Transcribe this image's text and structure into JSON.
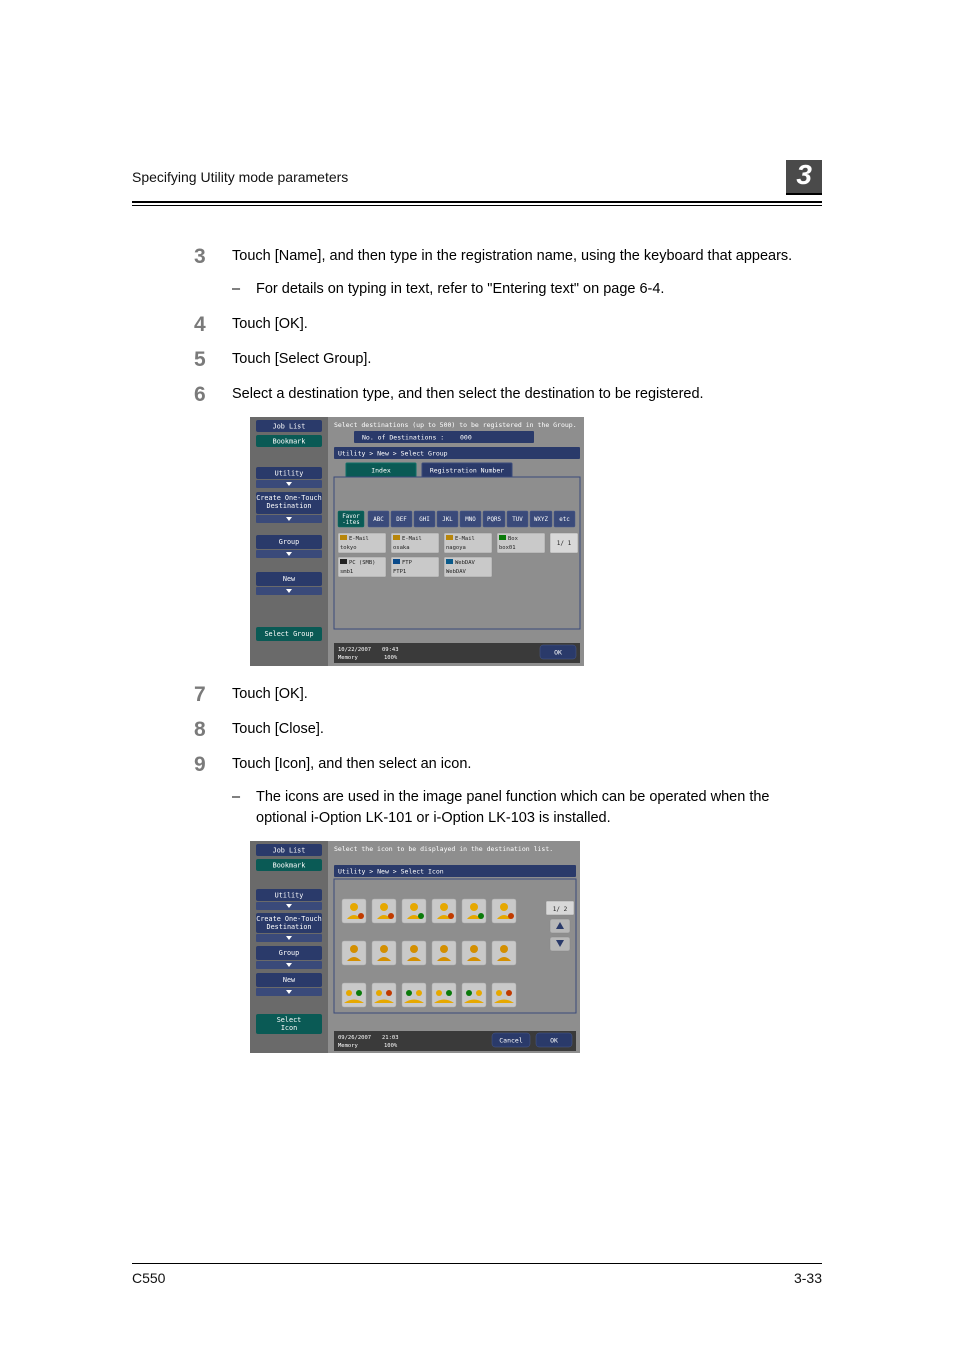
{
  "header": {
    "title": "Specifying Utility mode parameters",
    "chapter": "3"
  },
  "steps": {
    "s3": {
      "num": "3",
      "text": "Touch [Name], and then type in the registration name, using the keyboard that appears.",
      "sub": "For details on typing in text, refer to \"Entering text\" on page 6-4."
    },
    "s4": {
      "num": "4",
      "text": "Touch [OK]."
    },
    "s5": {
      "num": "5",
      "text": "Touch [Select Group]."
    },
    "s6": {
      "num": "6",
      "text": "Select a destination type, and then select the destination to be registered."
    },
    "s7": {
      "num": "7",
      "text": "Touch [OK]."
    },
    "s8": {
      "num": "8",
      "text": "Touch [Close]."
    },
    "s9": {
      "num": "9",
      "text": "Touch [Icon], and then select an icon.",
      "sub": "The icons are used in the image panel function which can be operated when the optional i-Option LK-101 or i-Option LK-103 is installed."
    }
  },
  "fig1": {
    "instr": "Select destinations (up to 500) to be registered in the Group.",
    "dest_count_label": "No. of Destinations :",
    "dest_count_value": "000",
    "crumb": "Utility > New > Select Group",
    "tab_index": "Index",
    "tab_regnum": "Registration Number",
    "sidebar": {
      "job_list": "Job List",
      "bookmark": "Bookmark",
      "utility": "Utility",
      "create": "Create One-Touch\nDestination",
      "group": "Group",
      "new": "New",
      "select_group": "Select Group"
    },
    "idx": {
      "favor": "Favor-\nites",
      "abc": "ABC",
      "def": "DEF",
      "ghi": "GHI",
      "jkl": "JKL",
      "mno": "MNO",
      "pqrs": "PQRS",
      "tuv": "TUV",
      "wxyz": "WXYZ",
      "etc": "etc"
    },
    "dest": {
      "d1": {
        "type": "E-Mail",
        "name": "tokyo"
      },
      "d2": {
        "type": "E-Mail",
        "name": "osaka"
      },
      "d3": {
        "type": "E-Mail",
        "name": "nagoya"
      },
      "d4": {
        "type": "Box",
        "name": "box01"
      },
      "d5": {
        "type": "PC (SMB)",
        "name": "smb1"
      },
      "d6": {
        "type": "FTP",
        "name": "FTP1"
      },
      "d7": {
        "type": "WebDAV",
        "name": "WebDAV"
      }
    },
    "pager": "1/  1",
    "ok": "OK",
    "status_date": "10/22/2007",
    "status_time": "09:43",
    "status_mem_label": "Memory",
    "status_mem_val": "100%"
  },
  "fig2": {
    "instr": "Select the icon to be displayed in the destination list.",
    "crumb": "Utility > New > Select Icon",
    "sidebar": {
      "job_list": "Job List",
      "bookmark": "Bookmark",
      "utility": "Utility",
      "create": "Create One-Touch\nDestination",
      "group": "Group",
      "new": "New",
      "select_icon": "Select\nIcon"
    },
    "pager": "1/  2",
    "ok": "OK",
    "cancel": "Cancel",
    "status_date": "09/26/2007",
    "status_time": "21:03",
    "status_mem_label": "Memory",
    "status_mem_val": "100%"
  },
  "footer": {
    "model": "C550",
    "pg": "3-33"
  }
}
